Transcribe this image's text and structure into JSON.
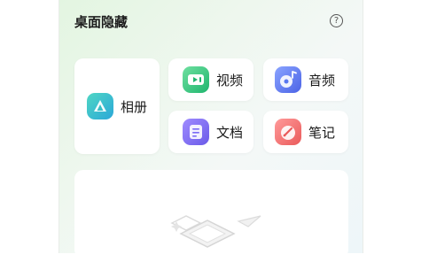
{
  "header": {
    "title": "桌面隐藏",
    "help_icon": "question-circle-icon"
  },
  "categories": [
    {
      "label": "相册",
      "icon": "album-icon",
      "color": "#33c2c9"
    },
    {
      "label": "视频",
      "icon": "video-icon",
      "color": "#2fc27a"
    },
    {
      "label": "音频",
      "icon": "audio-icon",
      "color": "#5a78f0"
    },
    {
      "label": "文档",
      "icon": "document-icon",
      "color": "#7b6cf5"
    },
    {
      "label": "笔记",
      "icon": "note-icon",
      "color": "#f06b6b"
    }
  ]
}
